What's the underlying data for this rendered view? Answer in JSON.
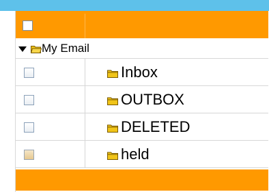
{
  "colors": {
    "accent": "#ff9900",
    "top_bar": "#5ec1ea",
    "folder": "#f0c419"
  },
  "tree": {
    "group": {
      "label": "My Email",
      "expanded": true,
      "icon": "folder-open-icon"
    },
    "items": [
      {
        "label": "Inbox",
        "icon": "folder-icon",
        "checked": false
      },
      {
        "label": "OUTBOX",
        "icon": "folder-icon",
        "checked": false
      },
      {
        "label": "DELETED",
        "icon": "folder-icon",
        "checked": false
      },
      {
        "label": "held",
        "icon": "folder-icon",
        "checked": false
      }
    ]
  }
}
